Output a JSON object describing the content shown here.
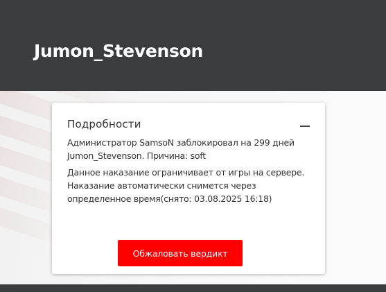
{
  "header": {
    "player_name": "Jumon_Stevenson"
  },
  "card": {
    "title": "Подробности",
    "collapse_icon": "minus-icon",
    "ban_info": "Администратор SamsoN заблокировал на 299 дней Jumon_Stevenson. Причина: soft",
    "punishment_info": "Данное наказание ограничивает от игры на сервере. Наказание автоматически снимется через определенное время(снято: 03.08.2025 16:18)",
    "appeal_button_label": "Обжаловать вердикт"
  },
  "colors": {
    "header_bg": "#3b3c3e",
    "accent": "#ff0000",
    "card_bg": "#ffffff"
  }
}
